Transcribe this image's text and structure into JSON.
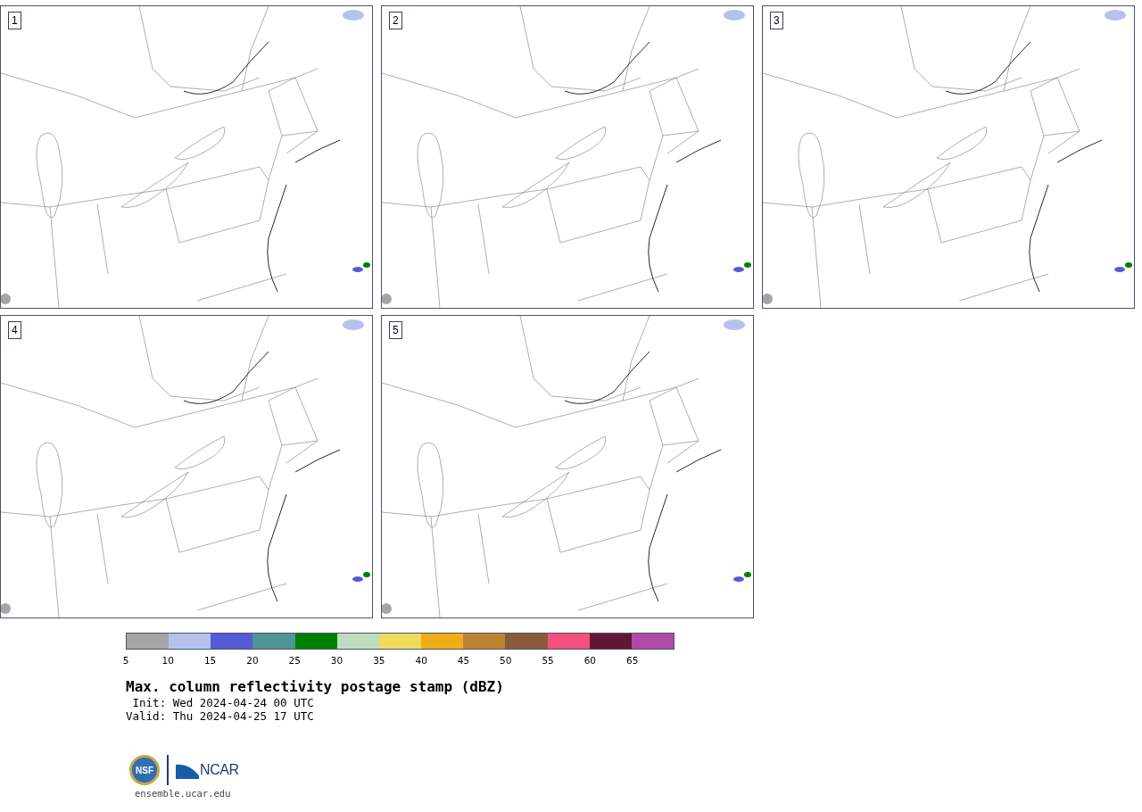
{
  "panels": [
    {
      "label": "1"
    },
    {
      "label": "2"
    },
    {
      "label": "3"
    },
    {
      "label": "4"
    },
    {
      "label": "5"
    }
  ],
  "colorbar": {
    "bins": [
      {
        "color": "#a5a5a5"
      },
      {
        "color": "#b7c2ec"
      },
      {
        "color": "#535bd6"
      },
      {
        "color": "#4e9598"
      },
      {
        "color": "#008000"
      },
      {
        "color": "#bfddbe"
      },
      {
        "color": "#efdb5c"
      },
      {
        "color": "#efae17"
      },
      {
        "color": "#bb8430"
      },
      {
        "color": "#8a5a3e"
      },
      {
        "color": "#f4507d"
      },
      {
        "color": "#621735"
      },
      {
        "color": "#ae4aa8"
      }
    ],
    "ticks": [
      "5",
      "10",
      "15",
      "20",
      "25",
      "30",
      "35",
      "40",
      "45",
      "50",
      "55",
      "60",
      "65"
    ]
  },
  "title": "Max. column reflectivity postage stamp (dBZ)",
  "init": " Init: Wed 2024-04-24 00 UTC",
  "valid": "Valid: Thu 2024-04-25 17 UTC",
  "logo": {
    "seal_text": "NSF",
    "name": "NCAR"
  },
  "footer": "ensemble.ucar.edu"
}
